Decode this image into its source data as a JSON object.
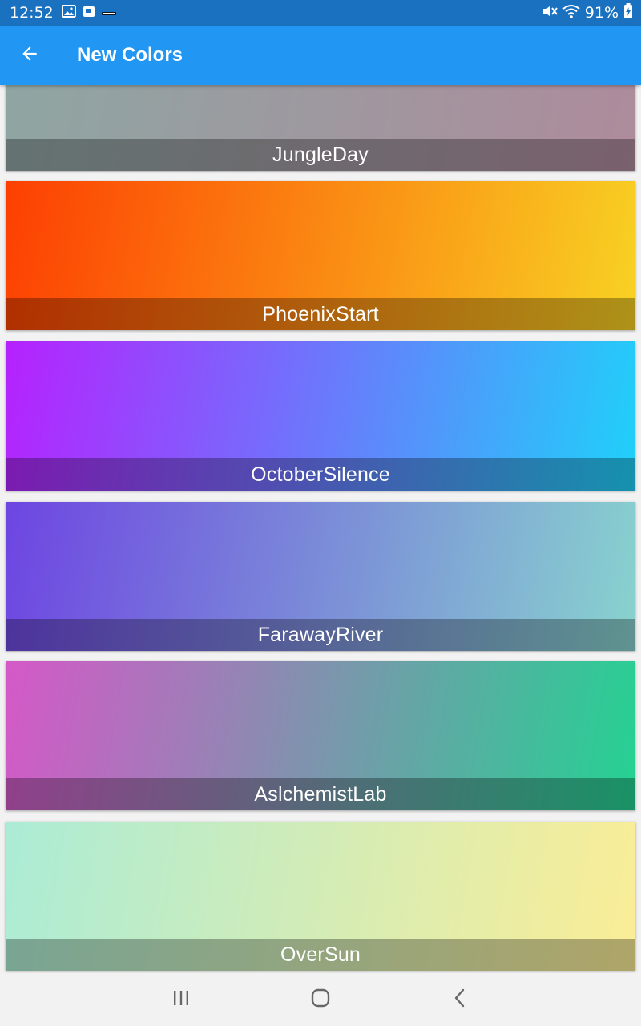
{
  "status_bar": {
    "time": "12:52",
    "battery_percent": "91%",
    "icons_left": [
      "image-icon",
      "app-notification-icon",
      "small-notification-icon"
    ],
    "icons_right": [
      "mute-icon",
      "wifi-icon",
      "battery-charging-icon"
    ]
  },
  "app_bar": {
    "title": "New Colors",
    "back_icon": "arrow-back-icon",
    "color": "#2196f3"
  },
  "gradients": [
    {
      "name": "JungleDay",
      "from": "#8ea6a3",
      "to": "#ae8b9c"
    },
    {
      "name": "PhoenixStart",
      "from": "#fd3f02",
      "to": "#f8d223"
    },
    {
      "name": "OctoberSilence",
      "from": "#b621fe",
      "to": "#1fd1f9"
    },
    {
      "name": "FarawayRiver",
      "from": "#6e45e2",
      "to": "#88d3ce"
    },
    {
      "name": "AslchemistLab",
      "from": "#d558c8",
      "to": "#24d292"
    },
    {
      "name": "OverSun",
      "from": "#abecd6",
      "to": "#fbed96"
    }
  ],
  "nav_bar": {
    "recents_icon": "recents-icon",
    "home_icon": "home-icon",
    "back_icon": "nav-back-icon"
  }
}
